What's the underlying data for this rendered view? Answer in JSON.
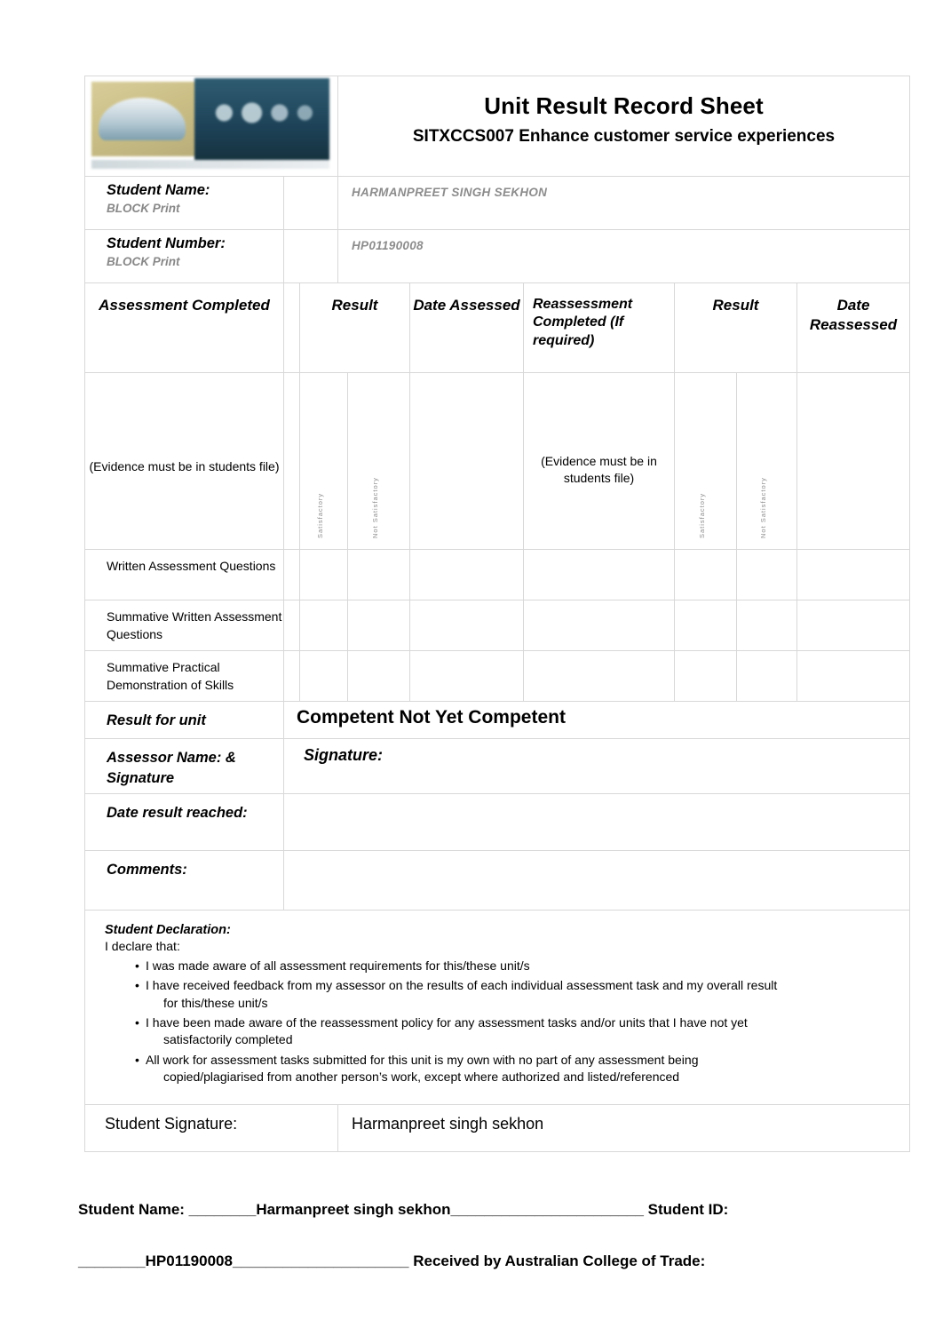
{
  "header": {
    "title": "Unit Result Record Sheet",
    "subtitle": "SITXCCS007 Enhance customer service experiences",
    "logo_name": "australian-college-of-trade-logo"
  },
  "student": {
    "name_label": "Student Name:",
    "name_sublabel": "BLOCK Print",
    "name_value": "HARMANPREET SINGH SEKHON",
    "number_label": "Student Number:",
    "number_sublabel": "BLOCK Print",
    "number_value": "HP01190008"
  },
  "table": {
    "headers": {
      "assessment_completed": "Assessment Completed",
      "result_1": "Result",
      "date_assessed": "Date Assessed",
      "reassessment_completed": "Reassessment  Completed (If required)",
      "result_2": "Result",
      "date_reassessed": "Date Reassessed"
    },
    "evidence_note_1": "(Evidence must be in students file)",
    "evidence_note_2": "(Evidence must be in  students file)",
    "vertical_labels": {
      "satisfactory": "Satisfactory",
      "not_satisfactory": "Not Satisfactory"
    },
    "rows": [
      {
        "task": "Written Assessment Questions"
      },
      {
        "task": "Summative Written Assessment Questions"
      },
      {
        "task": "Summative Practical Demonstration of Skills"
      }
    ]
  },
  "result_section": {
    "result_for_unit_label": "Result for unit",
    "result_for_unit_value": "Competent Not Yet Competent",
    "assessor_label": "Assessor Name: & Signature",
    "assessor_signature_label": "Signature:",
    "assessor_signature_value": "",
    "date_reached_label": "Date result reached:",
    "date_reached_value": "",
    "comments_label": "Comments:",
    "comments_value": ""
  },
  "declaration": {
    "title": "Student Declaration:",
    "intro": "I declare that:",
    "items": [
      {
        "text": "I was made aware of all assessment requirements for this/these unit/s",
        "cont": ""
      },
      {
        "text": "I have received feedback from my assessor on the results of each individual assessment task and my overall result",
        "cont": "for this/these unit/s"
      },
      {
        "text": "I have been made aware of the reassessment policy for any assessment tasks and/or units that I have not yet",
        "cont": "satisfactorily completed"
      },
      {
        "text": "All work for assessment tasks submitted for this unit is my own with no part of any assessment being",
        "cont": "copied/plagiarised from another person’s work, except where authorized and listed/referenced"
      }
    ]
  },
  "signature_row": {
    "label": "Student Signature:",
    "value": "Harmanpreet singh sekhon"
  },
  "footer": {
    "line1": "Student Name: ________Harmanpreet singh sekhon_______________________ Student ID:",
    "line2": "________HP01190008_____________________ Received by Australian College of Trade:"
  }
}
